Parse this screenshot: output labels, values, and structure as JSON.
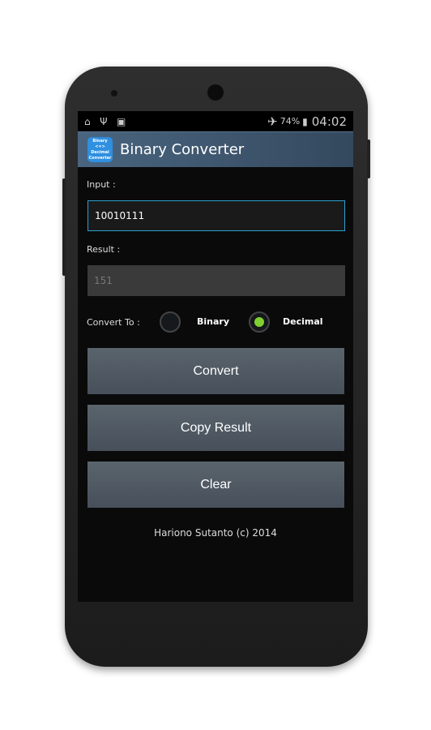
{
  "status_bar": {
    "icons": [
      "cleaner-icon",
      "usb-icon",
      "bbm-icon",
      "airplane-icon",
      "battery-charging-icon"
    ],
    "battery": "74%",
    "time": "04:02"
  },
  "action_bar": {
    "title": "Binary Converter",
    "logo_text": [
      "Binary",
      "<=>",
      "Decimal",
      "Converter"
    ]
  },
  "form": {
    "input_label": "Input :",
    "input_value": "10010111",
    "result_label": "Result :",
    "result_value": "151",
    "convert_to_label": "Convert To :",
    "options": [
      {
        "label": "Binary",
        "selected": false
      },
      {
        "label": "Decimal",
        "selected": true
      }
    ],
    "accent": "#7fd12f"
  },
  "buttons": {
    "convert": "Convert",
    "copy": "Copy Result",
    "clear": "Clear"
  },
  "footer": "Hariono Sutanto (c) 2014"
}
